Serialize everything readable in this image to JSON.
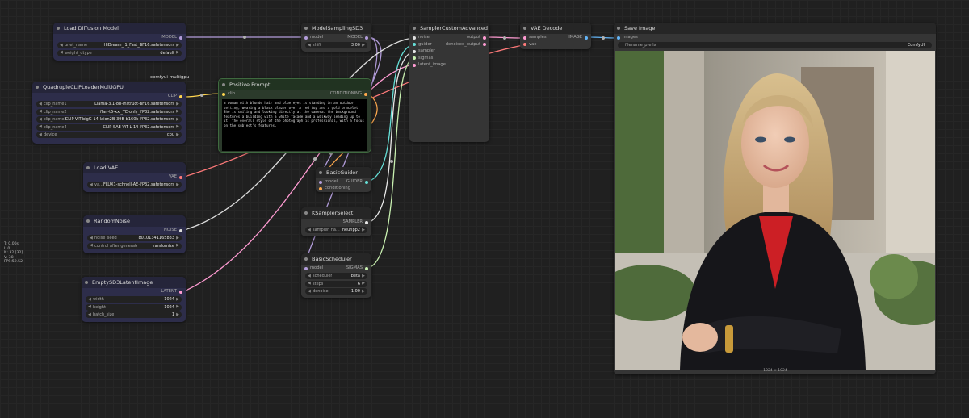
{
  "badges": {
    "multigpu": "comfyui-multigpu"
  },
  "stats": [
    "T: 0.00s",
    "I: 0",
    "N: 32 [32]",
    "V: 38",
    "FPS:59.52"
  ],
  "colors": {
    "model": "#b39ddb",
    "clip": "#ffd54f",
    "vae": "#ff7a7a",
    "conditioning": "#ffa94d",
    "noise": "#dddddd",
    "latent": "#ff9bd2",
    "image": "#64b5f6",
    "guider": "#66e0d8",
    "sigmas": "#c8f0b0",
    "sampler": "#e8e8e8"
  },
  "nodes": {
    "load_diffusion": {
      "title": "Load Diffusion Model",
      "out_model": "MODEL",
      "w1_label": "unet_name",
      "w1_value": "HiDream_I1_Fast_BF16.safetensors",
      "w2_label": "weight_dtype",
      "w2_value": "default"
    },
    "quad_clip": {
      "title": "QuadrupleCLIPLoaderMultiGPU",
      "out_clip": "CLIP",
      "widgets": [
        {
          "label": "clip_name1",
          "value": "Llama-3.1-8b-instruct-BF16.safetensors"
        },
        {
          "label": "clip_name2",
          "value": "flan-t5-xxl_TE-only_FP32.safetensors"
        },
        {
          "label": "clip_name3",
          "value": "CLIP-ViT-bigG-14-laion2B-39B-b160k-FP32.safetensors"
        },
        {
          "label": "clip_name4",
          "value": "CLIP-SAE-ViT-L-14-FP32.safetensors"
        },
        {
          "label": "device",
          "value": "cpu"
        }
      ]
    },
    "load_vae": {
      "title": "Load VAE",
      "out_vae": "VAE",
      "w1_label": "va...",
      "w1_value": "FLUX1-schnell-AE-FP32.safetensors"
    },
    "random_noise": {
      "title": "RandomNoise",
      "out_noise": "NOISE",
      "w1_label": "noise_seed",
      "w1_value": "80101341165833",
      "w2_label": "control after generate",
      "w2_value": "randomize"
    },
    "empty_latent": {
      "title": "EmptySD3LatentImage",
      "out_latent": "LATENT",
      "w1_label": "width",
      "w1_value": "1024",
      "w2_label": "height",
      "w2_value": "1024",
      "w3_label": "batch_size",
      "w3_value": "1"
    },
    "model_sampling": {
      "title": "ModelSamplingSD3",
      "in_model": "model",
      "out_model": "MODEL",
      "w1_label": "shift",
      "w1_value": "3.00"
    },
    "positive_prompt": {
      "title": "Positive Prompt",
      "in_clip": "clip",
      "out_cond": "CONDITIONING",
      "text": "a woman with blonde hair and blue eyes is standing in an outdoor setting, wearing a black blazer over a red top and a gold bracelet. She is smiling and looking directly at the camera. the background features a building with a white facade and a walkway leading up to it. the overall style of the photograph is professional, with a focus on the subject's features."
    },
    "basic_guider": {
      "title": "BasicGuider",
      "in_model": "model",
      "in_cond": "conditioning",
      "out_guider": "GUIDER"
    },
    "ksampler_select": {
      "title": "KSamplerSelect",
      "out_sampler": "SAMPLER",
      "w1_label": "sampler_na...",
      "w1_value": "heunpp2"
    },
    "basic_scheduler": {
      "title": "BasicScheduler",
      "in_model": "model",
      "out_sigmas": "SIGMAS",
      "w1_label": "scheduler",
      "w1_value": "beta",
      "w2_label": "steps",
      "w2_value": "6",
      "w3_label": "denoise",
      "w3_value": "1.00"
    },
    "sampler_custom": {
      "title": "SamplerCustomAdvanced",
      "in_noise": "noise",
      "in_guider": "guider",
      "in_sampler": "sampler",
      "in_sigmas": "sigmas",
      "in_latent": "latent_image",
      "out_output": "output",
      "out_denoised": "denoised_output"
    },
    "vae_decode": {
      "title": "VAE Decode",
      "in_samples": "samples",
      "in_vae": "vae",
      "out_image": "IMAGE"
    },
    "save_image": {
      "title": "Save Image",
      "in_images": "images",
      "w1_label": "filename_prefix",
      "w1_value": "ComfyUI",
      "image_size": "1024 × 1024"
    }
  }
}
